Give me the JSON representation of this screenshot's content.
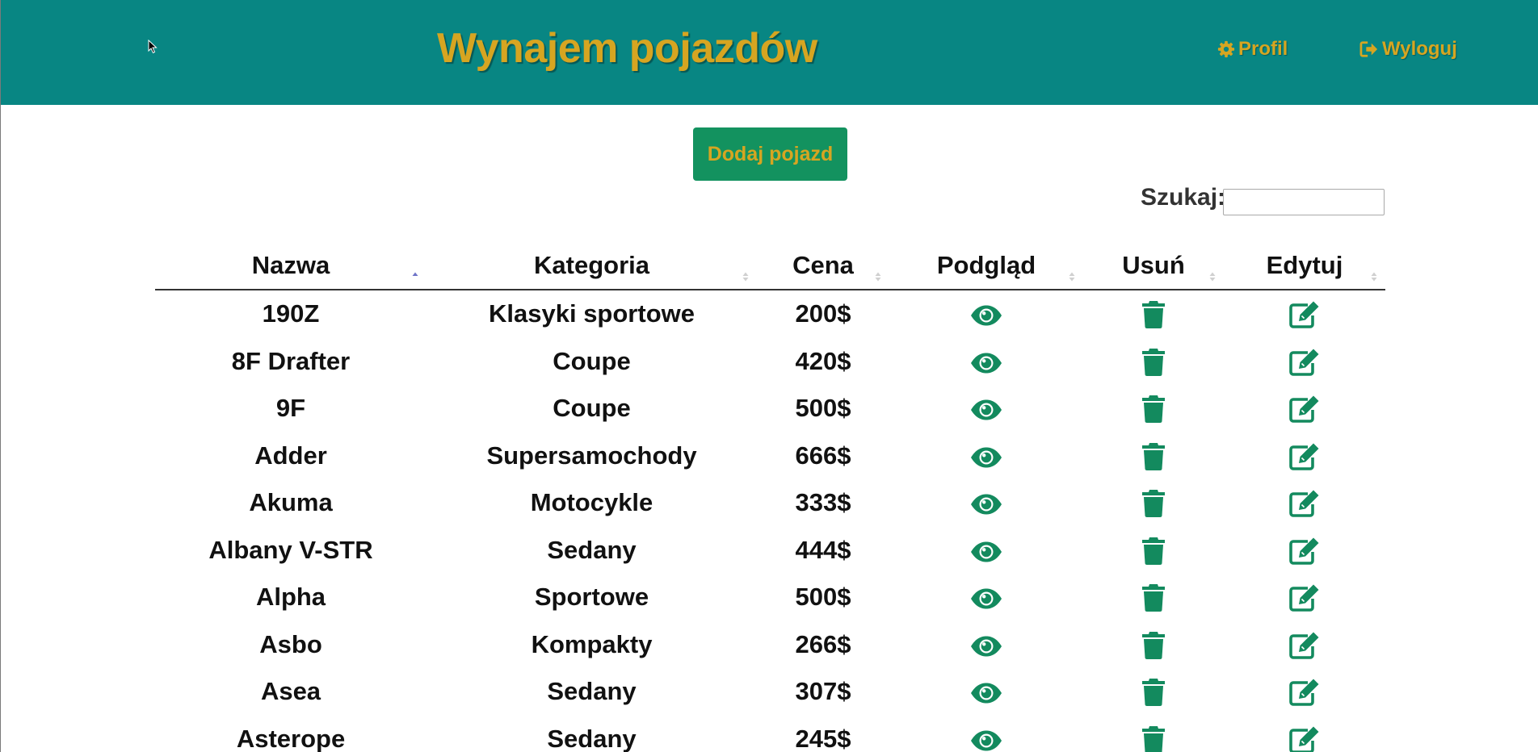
{
  "header": {
    "title": "Wynajem pojazdów",
    "profile_label": "Profil",
    "logout_label": "Wyloguj"
  },
  "actions": {
    "add_vehicle": "Dodaj pojazd"
  },
  "search": {
    "label": "Szukaj:",
    "value": ""
  },
  "table": {
    "columns": [
      "Nazwa",
      "Kategoria",
      "Cena",
      "Podgląd",
      "Usuń",
      "Edytuj"
    ],
    "sorted_column": "Nazwa",
    "sort_direction": "ascending",
    "rows": [
      {
        "name": "190Z",
        "category": "Klasyki sportowe",
        "price": "200$"
      },
      {
        "name": "8F Drafter",
        "category": "Coupe",
        "price": "420$"
      },
      {
        "name": "9F",
        "category": "Coupe",
        "price": "500$"
      },
      {
        "name": "Adder",
        "category": "Supersamochody",
        "price": "666$"
      },
      {
        "name": "Akuma",
        "category": "Motocykle",
        "price": "333$"
      },
      {
        "name": "Albany V-STR",
        "category": "Sedany",
        "price": "444$"
      },
      {
        "name": "Alpha",
        "category": "Sportowe",
        "price": "500$"
      },
      {
        "name": "Asbo",
        "category": "Kompakty",
        "price": "266$"
      },
      {
        "name": "Asea",
        "category": "Sedany",
        "price": "307$"
      },
      {
        "name": "Asterope",
        "category": "Sedany",
        "price": "245$"
      }
    ],
    "row_icons": [
      "eye-icon",
      "trash-icon",
      "edit-icon"
    ]
  },
  "colors": {
    "header_bg": "#088683",
    "accent_gold": "#d6a521",
    "button_green": "#13925f",
    "icon_green": "#138a5e",
    "sort_active": "#6e74c8",
    "sort_inactive": "#d0d0d0"
  }
}
